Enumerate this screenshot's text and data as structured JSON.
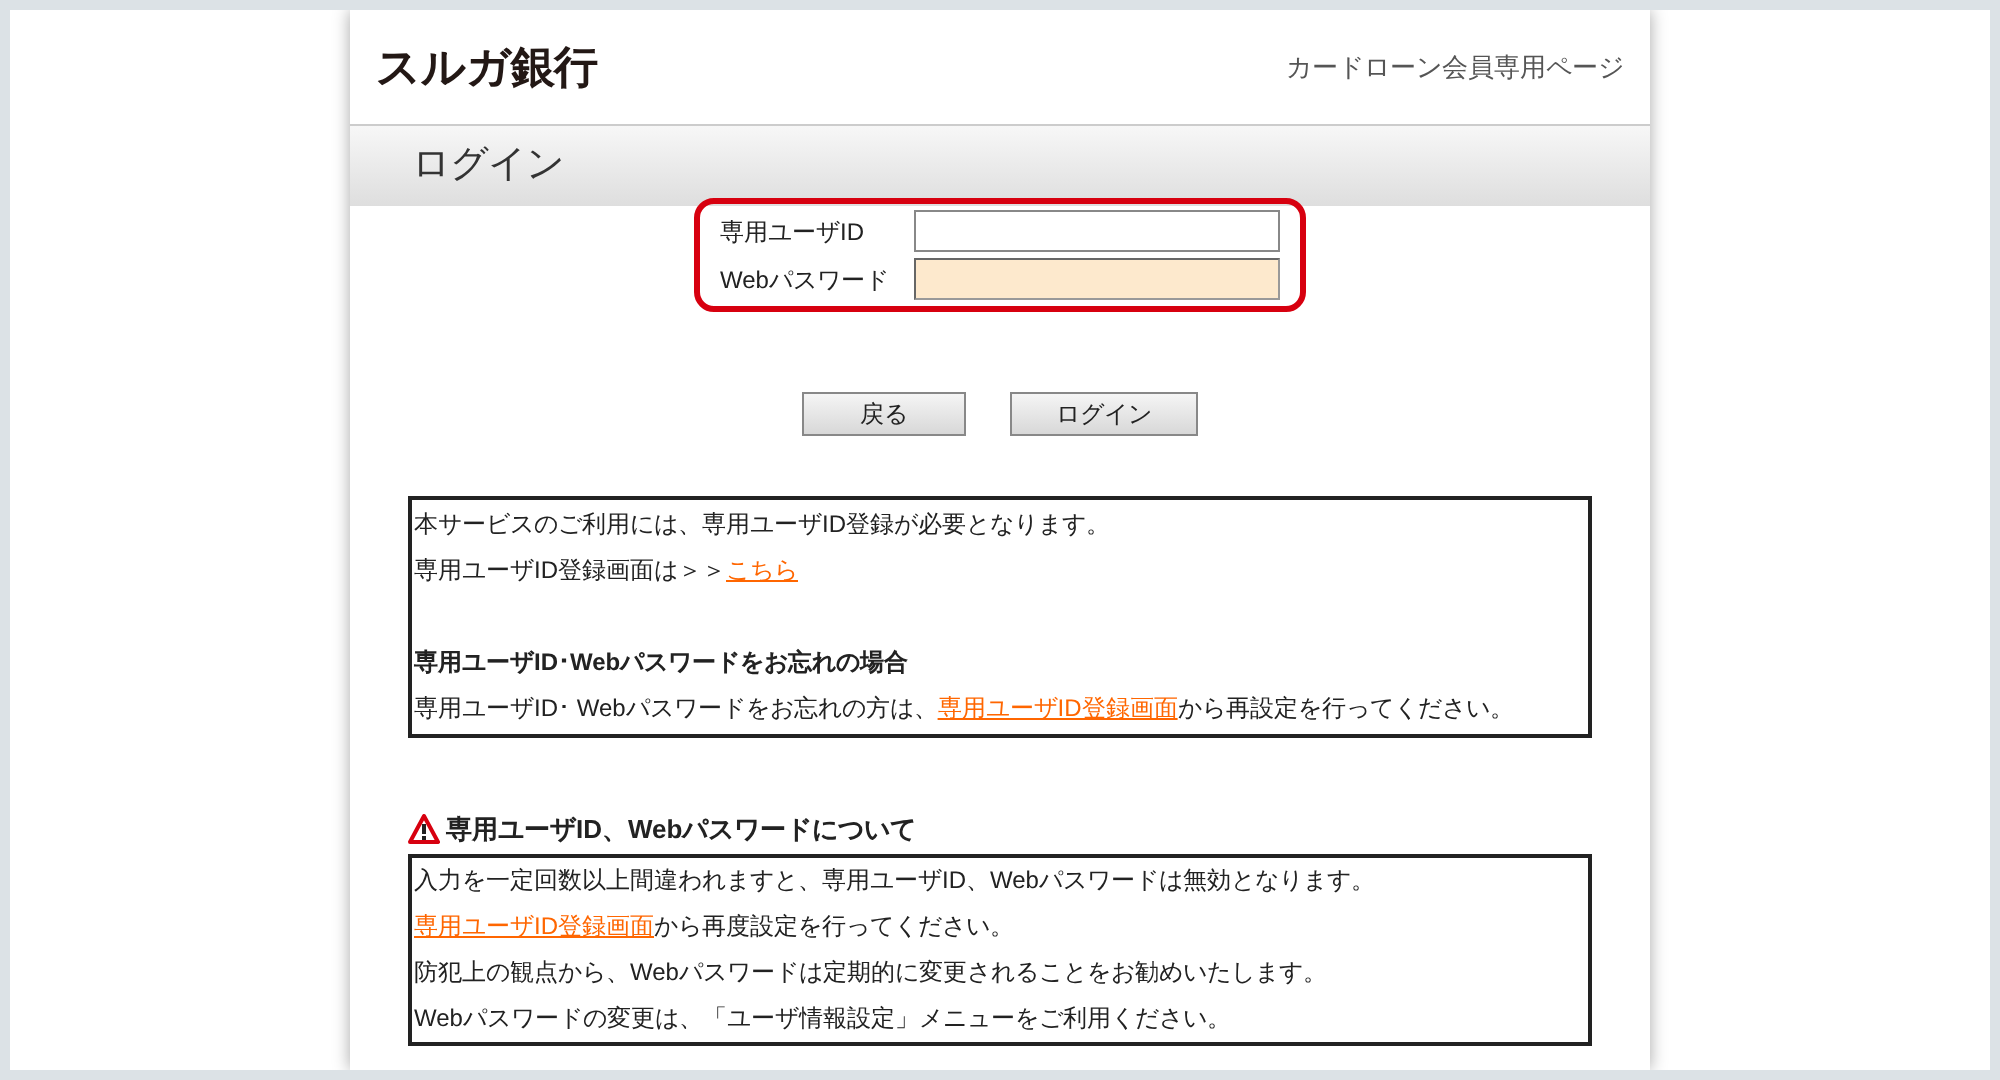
{
  "header": {
    "logo": "スルガ銀行",
    "subtitle": "カードローン会員専用ページ"
  },
  "title": "ログイン",
  "form": {
    "fields": [
      {
        "label": "専用ユーザID",
        "focused": false
      },
      {
        "label": "Webパスワード",
        "focused": true
      }
    ]
  },
  "buttons": [
    "戻る",
    "ログイン"
  ],
  "notice": {
    "lines": [
      {
        "text": "本サービスのご利用には、専用ユーザID登録が必要となります。"
      },
      {
        "text": "専用ユーザID登録画面は＞＞",
        "link": "こちら"
      }
    ],
    "forgot_heading": "専用ユーザID･Webパスワードをお忘れの場合",
    "forgot_line": {
      "text": "専用ユーザID･ Webパスワードをお忘れの方は、",
      "link": "専用ユーザID登録画面",
      "after": "から再設定を行ってください。"
    }
  },
  "warning": {
    "heading": "専用ユーザID、Webパスワードについて",
    "lines": [
      {
        "text": "入力を一定回数以上間違われますと、専用ユーザID、Webパスワードは無効となります。"
      },
      {
        "link": "専用ユーザID登録画面",
        "after": "から再度設定を行ってください。"
      },
      {
        "text": "防犯上の観点から、Webパスワードは定期的に変更されることをお勧めいたします。"
      },
      {
        "text": "Webパスワードの変更は、「ユーザ情報設定」メニューをご利用ください。"
      }
    ]
  }
}
